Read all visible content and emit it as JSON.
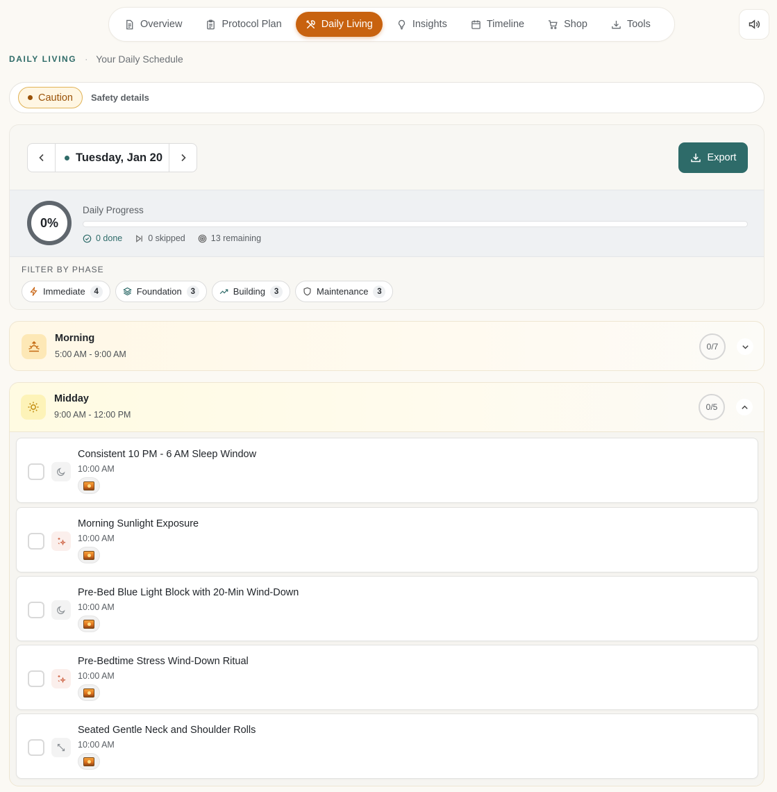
{
  "nav": {
    "tabs": [
      {
        "label": "Overview",
        "icon": "document-icon"
      },
      {
        "label": "Protocol Plan",
        "icon": "clipboard-icon"
      },
      {
        "label": "Daily Living",
        "icon": "utensils-icon",
        "active": true
      },
      {
        "label": "Insights",
        "icon": "lightbulb-icon"
      },
      {
        "label": "Timeline",
        "icon": "calendar-icon"
      },
      {
        "label": "Shop",
        "icon": "cart-icon"
      },
      {
        "label": "Tools",
        "icon": "download-icon"
      }
    ],
    "sound_icon": "speaker-icon"
  },
  "breadcrumb": {
    "section": "DAILY LIVING",
    "separator": "·",
    "subtitle": "Your Daily Schedule"
  },
  "safety": {
    "badge": "Caution",
    "details_label": "Safety details"
  },
  "schedule": {
    "date": "Tuesday, Jan 20",
    "export_label": "Export",
    "progress": {
      "percent_label": "0%",
      "percent": 0,
      "title": "Daily Progress",
      "done": "0 done",
      "skipped": "0 skipped",
      "remaining": "13 remaining"
    },
    "filter_label": "FILTER BY PHASE",
    "phases": [
      {
        "label": "Immediate",
        "count": "4",
        "icon": "lightning-icon"
      },
      {
        "label": "Foundation",
        "count": "3",
        "icon": "layers-icon"
      },
      {
        "label": "Building",
        "count": "3",
        "icon": "trending-up-icon"
      },
      {
        "label": "Maintenance",
        "count": "3",
        "icon": "shield-icon"
      }
    ]
  },
  "blocks": {
    "morning": {
      "title": "Morning",
      "time": "5:00 AM - 9:00 AM",
      "count": "0/7",
      "icon": "sunrise-icon",
      "expanded": false
    },
    "midday": {
      "title": "Midday",
      "time": "9:00 AM - 12:00 PM",
      "count": "0/5",
      "icon": "sun-icon",
      "expanded": true,
      "tasks": [
        {
          "name": "Consistent 10 PM - 6 AM Sleep Window",
          "time": "10:00 AM",
          "icon": "moon-icon"
        },
        {
          "name": "Morning Sunlight Exposure",
          "time": "10:00 AM",
          "icon": "sparkle-icon"
        },
        {
          "name": "Pre-Bed Blue Light Block with 20-Min Wind-Down",
          "time": "10:00 AM",
          "icon": "moon-icon"
        },
        {
          "name": "Pre-Bedtime Stress Wind-Down Ritual",
          "time": "10:00 AM",
          "icon": "sparkle-icon"
        },
        {
          "name": "Seated Gentle Neck and Shoulder Rolls",
          "time": "10:00 AM",
          "icon": "stretch-icon"
        }
      ]
    }
  },
  "colors": {
    "accent": "#c8620f",
    "primary": "#2e6b69",
    "caution_text": "#9a5208",
    "caution_bg": "#fff6e3"
  }
}
